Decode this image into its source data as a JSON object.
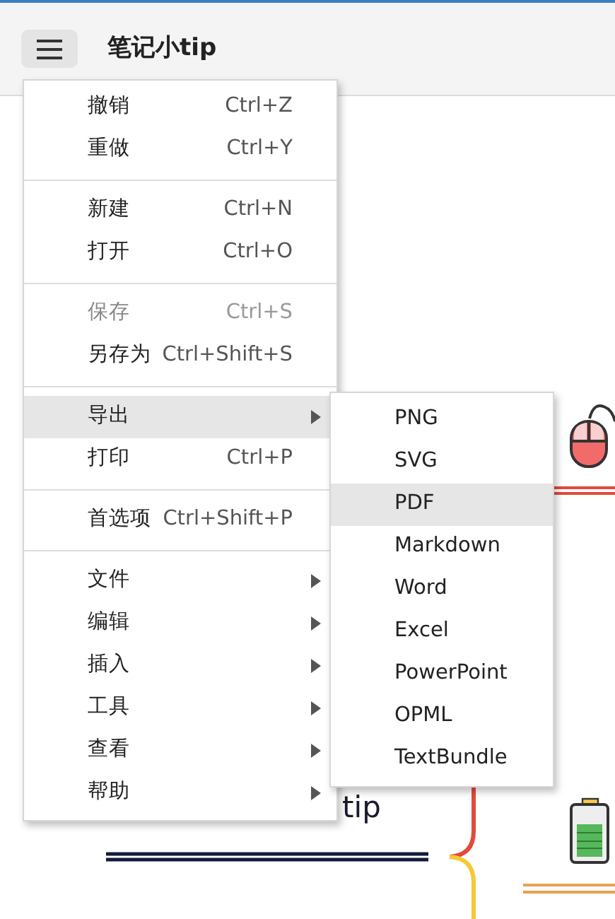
{
  "app": {
    "title": "笔记小tip"
  },
  "menu": {
    "sections": [
      [
        {
          "label": "撤销",
          "shortcut": "Ctrl+Z",
          "submenu": false,
          "disabled": false,
          "selected": false
        },
        {
          "label": "重做",
          "shortcut": "Ctrl+Y",
          "submenu": false,
          "disabled": false,
          "selected": false
        }
      ],
      [
        {
          "label": "新建",
          "shortcut": "Ctrl+N",
          "submenu": false,
          "disabled": false,
          "selected": false
        },
        {
          "label": "打开",
          "shortcut": "Ctrl+O",
          "submenu": false,
          "disabled": false,
          "selected": false
        }
      ],
      [
        {
          "label": "保存",
          "shortcut": "Ctrl+S",
          "submenu": false,
          "disabled": true,
          "selected": false
        },
        {
          "label": "另存为",
          "shortcut": "Ctrl+Shift+S",
          "submenu": false,
          "disabled": false,
          "selected": false
        }
      ],
      [
        {
          "label": "导出",
          "submenu": true,
          "disabled": false,
          "selected": true
        },
        {
          "label": "打印",
          "shortcut": "Ctrl+P",
          "submenu": false,
          "disabled": false,
          "selected": false
        }
      ],
      [
        {
          "label": "首选项",
          "shortcut": "Ctrl+Shift+P",
          "submenu": false,
          "disabled": false,
          "selected": false
        }
      ],
      [
        {
          "label": "文件",
          "submenu": true,
          "disabled": false,
          "selected": false
        },
        {
          "label": "编辑",
          "submenu": true,
          "disabled": false,
          "selected": false
        },
        {
          "label": "插入",
          "submenu": true,
          "disabled": false,
          "selected": false
        },
        {
          "label": "工具",
          "submenu": true,
          "disabled": false,
          "selected": false
        },
        {
          "label": "查看",
          "submenu": true,
          "disabled": false,
          "selected": false
        },
        {
          "label": "帮助",
          "submenu": true,
          "disabled": false,
          "selected": false
        }
      ]
    ]
  },
  "submenu": {
    "items": [
      {
        "label": "PNG",
        "selected": false
      },
      {
        "label": "SVG",
        "selected": false
      },
      {
        "label": "PDF",
        "selected": true
      },
      {
        "label": "Markdown",
        "selected": false
      },
      {
        "label": "Word",
        "selected": false
      },
      {
        "label": "Excel",
        "selected": false
      },
      {
        "label": "PowerPoint",
        "selected": false
      },
      {
        "label": "OPML",
        "selected": false
      },
      {
        "label": "TextBundle",
        "selected": false
      }
    ]
  },
  "canvas": {
    "node_text": "tip"
  }
}
